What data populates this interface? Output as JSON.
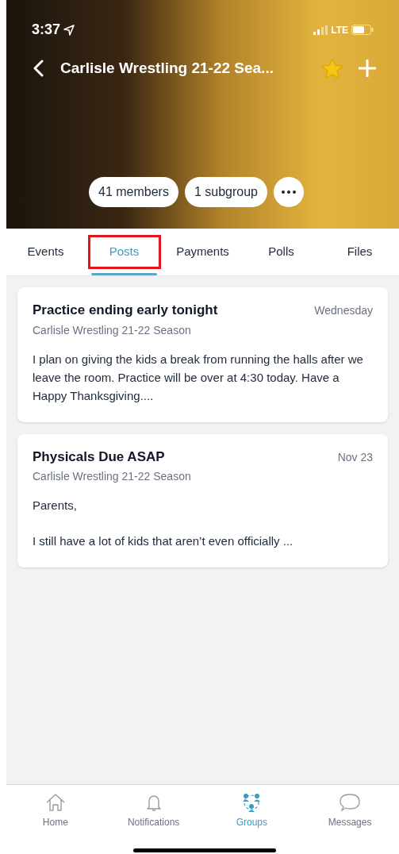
{
  "status_bar": {
    "time": "3:37",
    "network": "LTE"
  },
  "header": {
    "title": "Carlisle Wrestling 21-22 Sea...",
    "favorite": true,
    "chips": [
      "41 members",
      "1 subgroup"
    ]
  },
  "tabs": [
    {
      "label": "Events",
      "selected": false,
      "highlighted": false
    },
    {
      "label": "Posts",
      "selected": true,
      "highlighted": true
    },
    {
      "label": "Payments",
      "selected": false,
      "highlighted": false
    },
    {
      "label": "Polls",
      "selected": false,
      "highlighted": false
    },
    {
      "label": "Files",
      "selected": false,
      "highlighted": false
    }
  ],
  "posts": [
    {
      "title": "Practice ending early tonight",
      "date": "Wednesday",
      "group": "Carlisle Wrestling 21-22 Season",
      "paragraphs": [
        "I plan on giving the kids a break from running the halls after we leave the room. Practice will be over at 4:30 today. Have a Happy Thanksgiving...."
      ]
    },
    {
      "title": "Physicals Due ASAP",
      "date": "Nov 23",
      "group": "Carlisle Wrestling 21-22 Season",
      "paragraphs": [
        "Parents,",
        "I still have a lot of kids that aren’t even officially ..."
      ]
    }
  ],
  "bottom_nav": [
    {
      "label": "Home",
      "kind": "home",
      "selected": false
    },
    {
      "label": "Notifications",
      "kind": "bell",
      "selected": false
    },
    {
      "label": "Groups",
      "kind": "groups",
      "selected": true
    },
    {
      "label": "Messages",
      "kind": "chat",
      "selected": false
    }
  ]
}
